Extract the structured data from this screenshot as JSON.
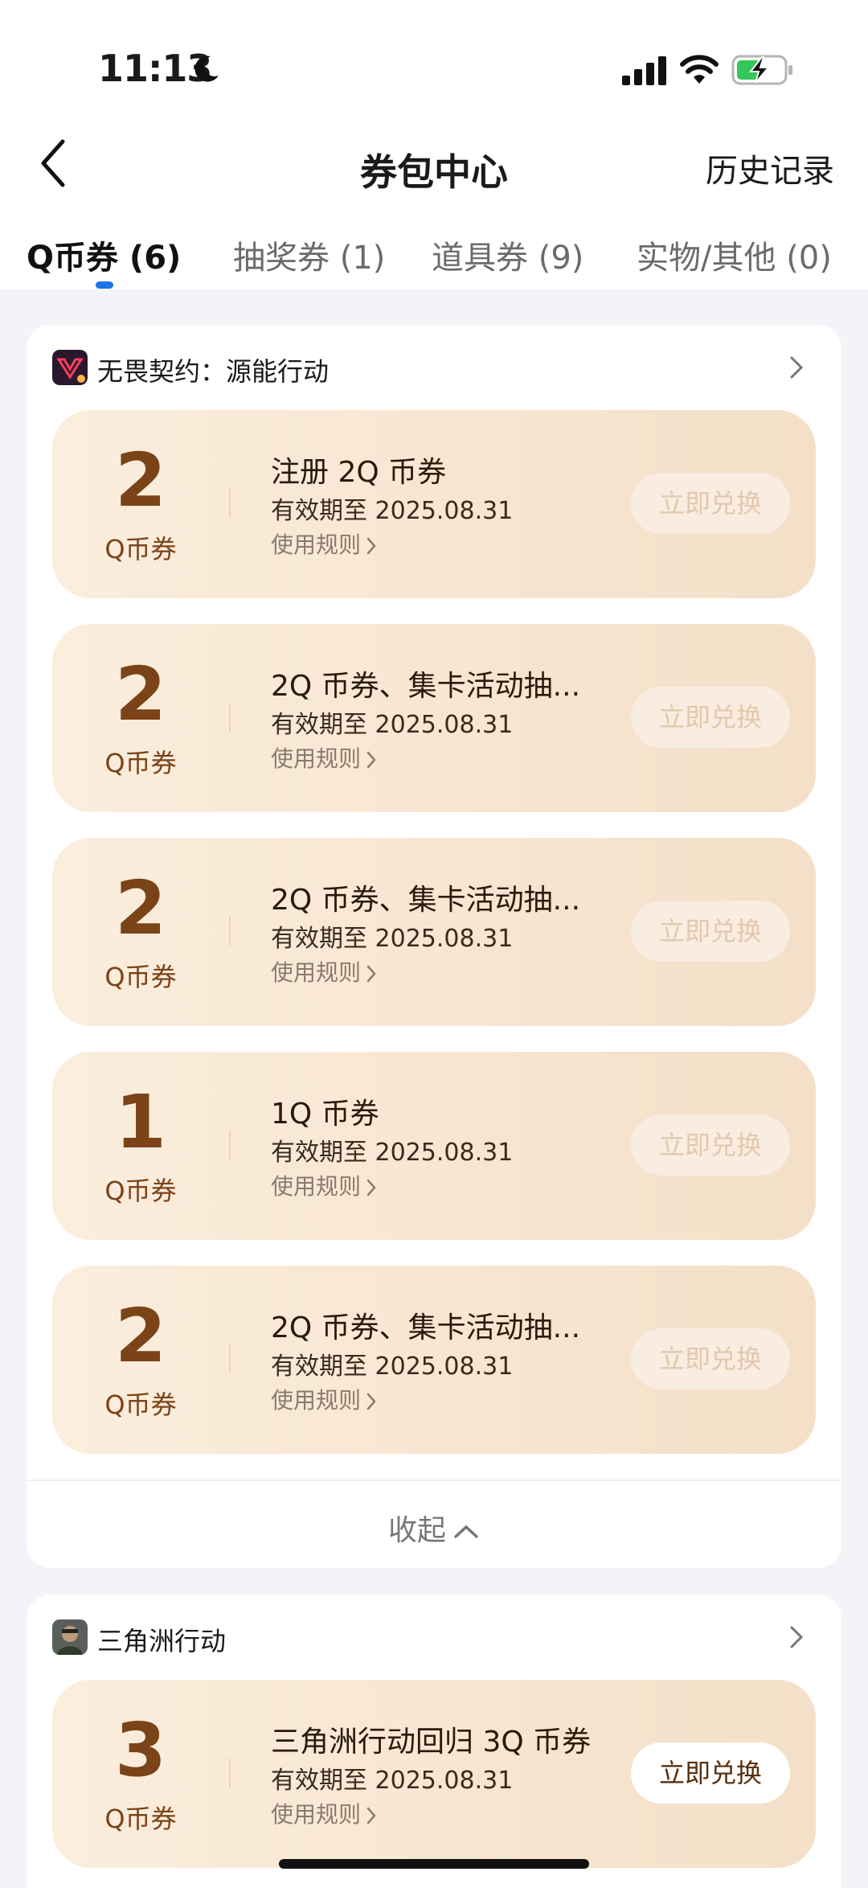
{
  "status_bar": {
    "time": "11:13"
  },
  "header": {
    "title": "券包中心",
    "history": "历史记录"
  },
  "tabs": [
    {
      "label": "Q币券 (6)"
    },
    {
      "label": "抽奖券 (1)"
    },
    {
      "label": "道具券 (9)"
    },
    {
      "label": "实物/其他 (0)"
    }
  ],
  "groups": [
    {
      "name": "无畏契约：源能行动",
      "coupons": [
        {
          "value": "2",
          "unit": "Q币券",
          "name": "注册 2Q 币券",
          "expiry": "有效期至 2025.08.31",
          "rule": "使用规则",
          "button": "立即兑换"
        },
        {
          "value": "2",
          "unit": "Q币券",
          "name": "2Q 币券、集卡活动抽...",
          "expiry": "有效期至 2025.08.31",
          "rule": "使用规则",
          "button": "立即兑换"
        },
        {
          "value": "2",
          "unit": "Q币券",
          "name": "2Q 币券、集卡活动抽...",
          "expiry": "有效期至 2025.08.31",
          "rule": "使用规则",
          "button": "立即兑换"
        },
        {
          "value": "1",
          "unit": "Q币券",
          "name": "1Q 币券",
          "expiry": "有效期至 2025.08.31",
          "rule": "使用规则",
          "button": "立即兑换"
        },
        {
          "value": "2",
          "unit": "Q币券",
          "name": "2Q 币券、集卡活动抽...",
          "expiry": "有效期至 2025.08.31",
          "rule": "使用规则",
          "button": "立即兑换"
        }
      ],
      "collapse": "收起"
    },
    {
      "name": "三角洲行动",
      "coupons": [
        {
          "value": "3",
          "unit": "Q币券",
          "name": "三角洲行动回归 3Q 币券",
          "expiry": "有效期至 2025.08.31",
          "rule": "使用规则",
          "button": "立即兑换"
        }
      ]
    }
  ],
  "colors": {
    "accent": "#1a73e8",
    "coupon_text": "#7b4318",
    "coupon_bg": "#f7e6d2"
  }
}
